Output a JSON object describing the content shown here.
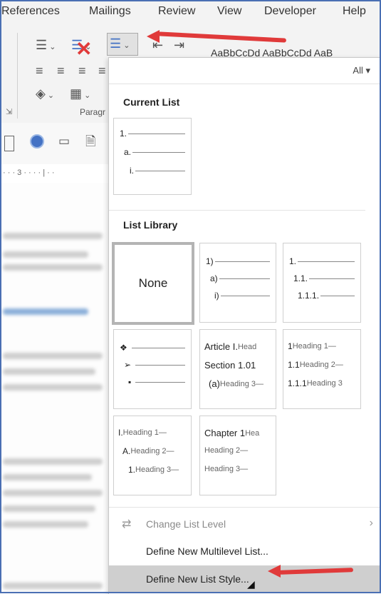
{
  "ribbon": {
    "tabs": [
      "References",
      "Mailings",
      "Review",
      "View",
      "Developer",
      "Help"
    ],
    "group_label": "Paragr",
    "style_preview": "AaBbCcDd  AaBbCcDd  AaB",
    "ruler_text": "· · · 3 · · · · | · ·"
  },
  "dropdown": {
    "filter_label": "All ▾",
    "current_list": {
      "heading": "Current List",
      "rows": [
        "1.",
        "a.",
        "i."
      ]
    },
    "list_library": {
      "heading": "List Library",
      "none_label": "None",
      "paren_rows": [
        "1)",
        "a)",
        "i)"
      ],
      "decimal_rows": [
        "1.",
        "1.1.",
        "1.1.1."
      ],
      "bullet_rows": [
        "❖",
        "➢",
        "▪"
      ],
      "article": {
        "r1a": "Article I.",
        "r1b": "Head",
        "r2a": "Section 1.01",
        "r2b": "",
        "r3a": "(a)",
        "r3b": "Heading 3—"
      },
      "heading_numbered": {
        "r1a": "1",
        "r1b": "Heading 1—",
        "r2a": "1.1",
        "r2b": "Heading 2—",
        "r3a": "1.1.1",
        "r3b": "Heading 3"
      },
      "roman": {
        "r1a": "I.",
        "r1b": "Heading 1—",
        "r2a": "A.",
        "r2b": "Heading 2—",
        "r3a": "1.",
        "r3b": "Heading 3—"
      },
      "chapter": {
        "r1a": "Chapter 1",
        "r1b": "Hea",
        "r2b": "Heading 2—",
        "r3b": "Heading 3—"
      }
    },
    "menu": {
      "change_level": "Change List Level",
      "define_multilevel": "Define New Multilevel List...",
      "define_style": "Define New List Style..."
    }
  },
  "colors": {
    "accent_arrow": "#e03a3a",
    "highlight": "#cfcfcf",
    "ribbon_bg": "#f3f3f3"
  }
}
